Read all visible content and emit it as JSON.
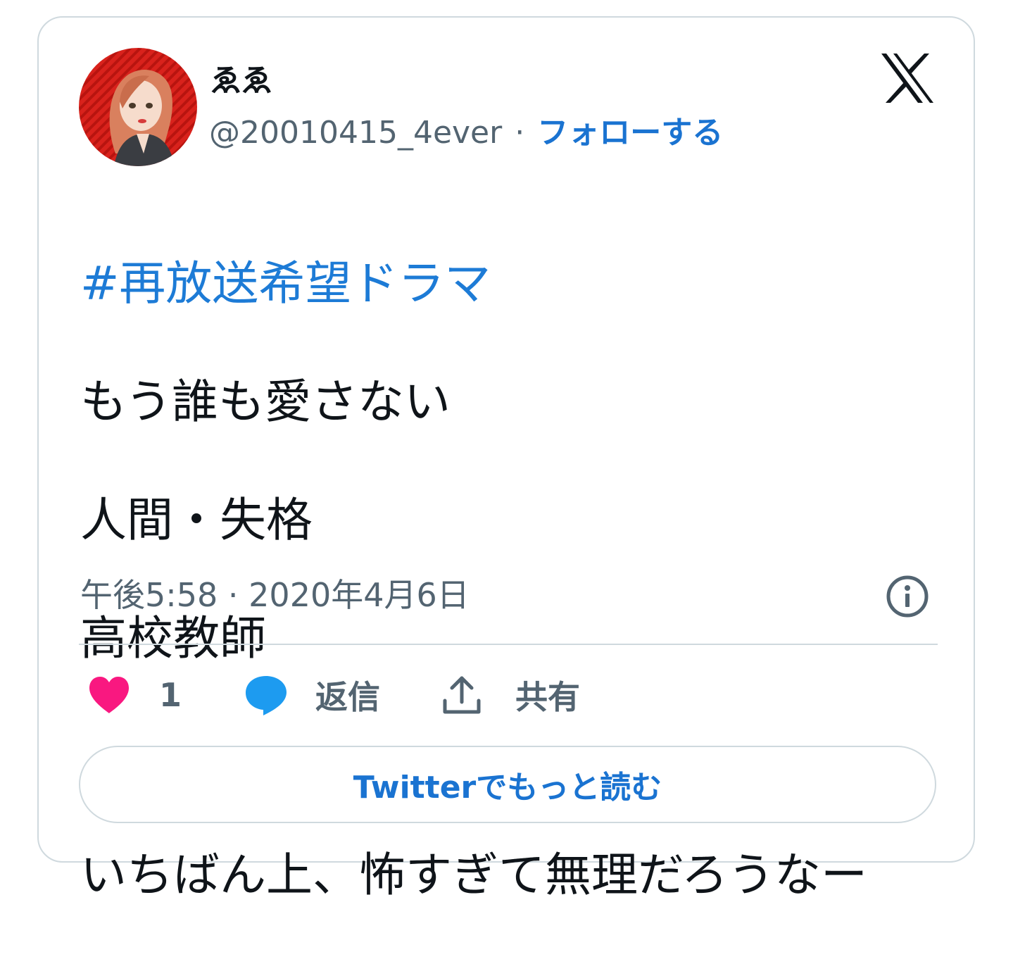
{
  "author": {
    "display_name": "ゑゑ",
    "handle": "@20010415_4ever",
    "separator": "·",
    "follow_label": "フォローする"
  },
  "tweet": {
    "hashtag": "#再放送希望ドラマ",
    "lines": [
      "もう誰も愛さない",
      "人間・失格",
      "高校教師",
      "",
      "いちばん上、怖すぎて無理だろうなー"
    ],
    "timestamp": "午後5:58 · 2020年4月6日"
  },
  "actions": {
    "like_count": "1",
    "reply_label": "返信",
    "share_label": "共有"
  },
  "read_more_label": "Twitterでもっと読む",
  "colors": {
    "link": "#1a73d1",
    "like": "#f91880",
    "reply": "#1d9bf0",
    "muted": "#536471",
    "border": "#cfd9de"
  },
  "icons": {
    "logo": "x-logo-icon",
    "info": "info-icon",
    "like": "heart-icon",
    "reply": "speech-bubble-icon",
    "share": "share-upload-icon"
  }
}
